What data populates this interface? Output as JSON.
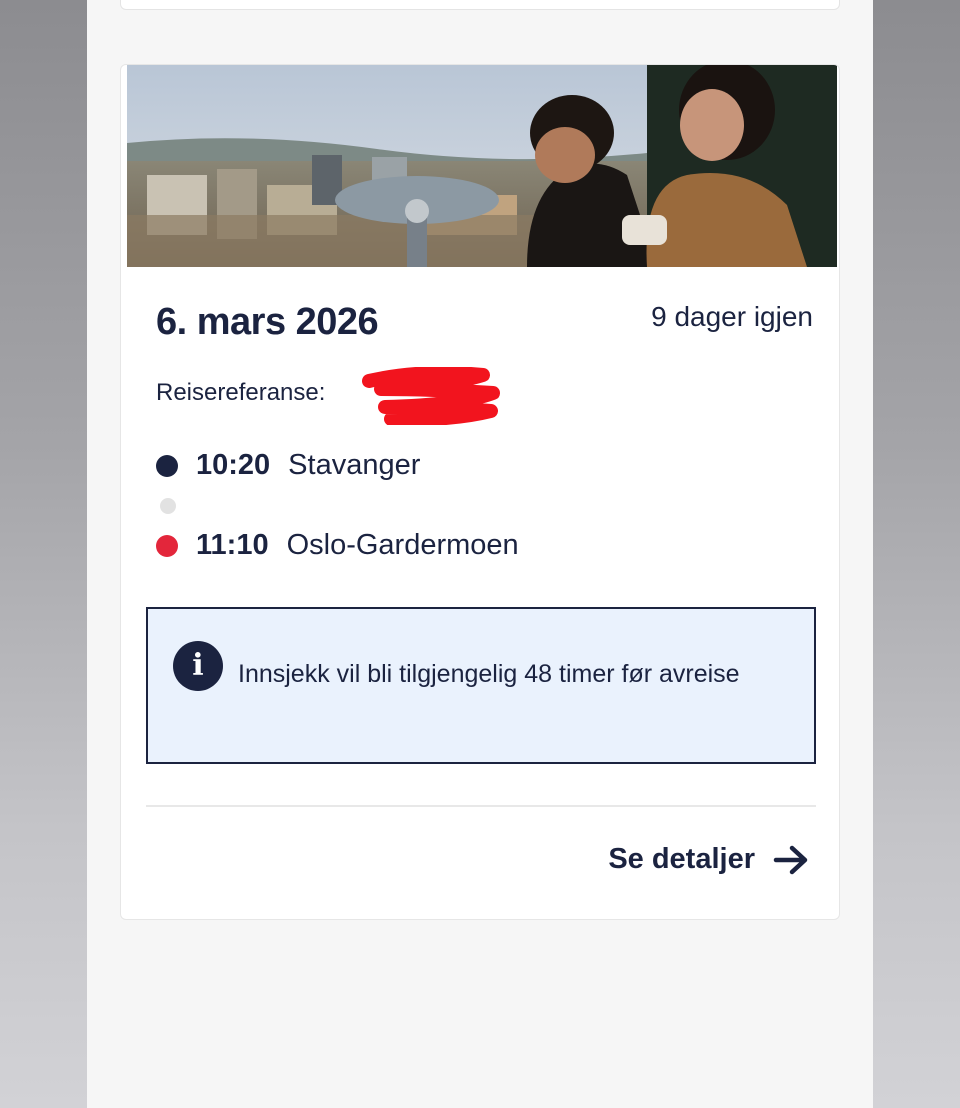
{
  "trip": {
    "date": "6. mars 2026",
    "days_left": "9 dager igjen",
    "reference_label": "Reisereferanse:",
    "departure": {
      "time": "10:20",
      "place": "Stavanger"
    },
    "arrival": {
      "time": "11:10",
      "place": "Oslo-Gardermoen"
    }
  },
  "info": {
    "icon": "info-icon",
    "text": "Innsjekk vil bli tilgjengelig 48 timer før avreise"
  },
  "actions": {
    "details_label": "Se detaljer",
    "details_icon": "arrow-right-icon"
  },
  "colors": {
    "navy": "#1b2340",
    "red": "#e3263b",
    "info_bg": "#eaf2fd"
  }
}
